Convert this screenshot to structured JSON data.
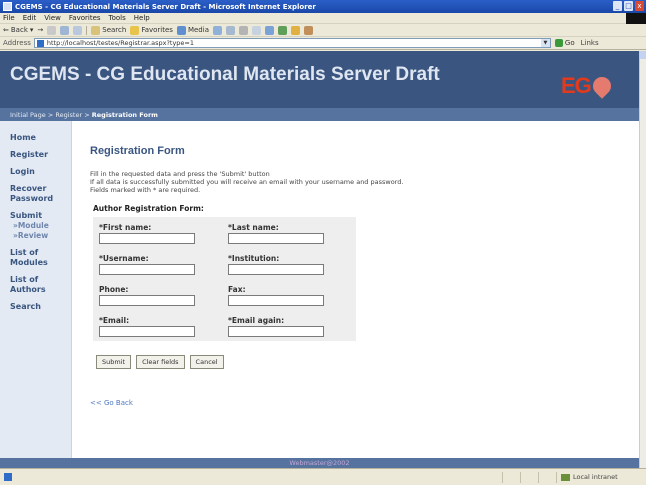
{
  "window": {
    "title": "CGEMS - CG Educational Materials Server Draft - Microsoft Internet Explorer",
    "controls": [
      "_",
      "□",
      "x"
    ]
  },
  "menu": [
    "File",
    "Edit",
    "View",
    "Favorites",
    "Tools",
    "Help"
  ],
  "toolbar": {
    "back": "Back",
    "search": "Search",
    "favorites": "Favorites",
    "media": "Media"
  },
  "address": {
    "label": "Address",
    "url": "http://localhost/testes/Registrar.aspx?type=1",
    "go": "Go",
    "links": "Links"
  },
  "banner": {
    "title": "CGEMS - CG Educational Materials Server Draft",
    "logo_text": "EG"
  },
  "breadcrumb": {
    "item1": "Initial Page",
    "sep": " > ",
    "item2": "Register",
    "current": "Registration Form"
  },
  "sidebar": {
    "items": [
      {
        "label": "Home",
        "lines": [
          "Home"
        ]
      },
      {
        "label": "Register",
        "lines": [
          "Register"
        ]
      },
      {
        "label": "Login",
        "lines": [
          "Login"
        ]
      },
      {
        "label": "Recover Password",
        "lines": [
          "Recover",
          "Password"
        ]
      },
      {
        "label": "Submit",
        "lines": [
          "Submit"
        ]
      },
      {
        "label": "»Module",
        "lines": [
          "»Module"
        ]
      },
      {
        "label": "»Review",
        "lines": [
          "»Review"
        ]
      },
      {
        "label": "List of Modules",
        "lines": [
          "List of",
          "Modules"
        ]
      },
      {
        "label": "List of Authors",
        "lines": [
          "List of",
          "Authors"
        ]
      },
      {
        "label": "Search",
        "lines": [
          "Search"
        ]
      }
    ]
  },
  "content": {
    "heading": "Registration Form",
    "intro": [
      "Fill in the requested data and press the 'Submit' button",
      "If all data is successfully submitted you will receive an email with your username and password.",
      "Fields marked with * are required."
    ],
    "form_title": "Author Registration Form:",
    "fields": {
      "first_name": {
        "label": "*First name:",
        "value": ""
      },
      "last_name": {
        "label": "*Last name:",
        "value": ""
      },
      "username": {
        "label": "*Username:",
        "value": ""
      },
      "institution": {
        "label": "*Institution:",
        "value": ""
      },
      "phone": {
        "label": "Phone:",
        "value": ""
      },
      "fax": {
        "label": "Fax:",
        "value": ""
      },
      "email": {
        "label": "*Email:",
        "value": ""
      },
      "email_again": {
        "label": "*Email again:",
        "value": ""
      }
    },
    "buttons": {
      "submit": "Submit",
      "clear": "Clear fields",
      "cancel": "Cancel"
    },
    "go_back": "<< Go Back"
  },
  "footer": "Webmaster@2002",
  "status": {
    "zone": "Local intranet"
  },
  "colors": {
    "banner": "#3a5680",
    "crumbbar": "#56729e",
    "sidebar": "#e3eaf4",
    "heading": "#3a5680",
    "logo_red": "#e23a1a"
  }
}
